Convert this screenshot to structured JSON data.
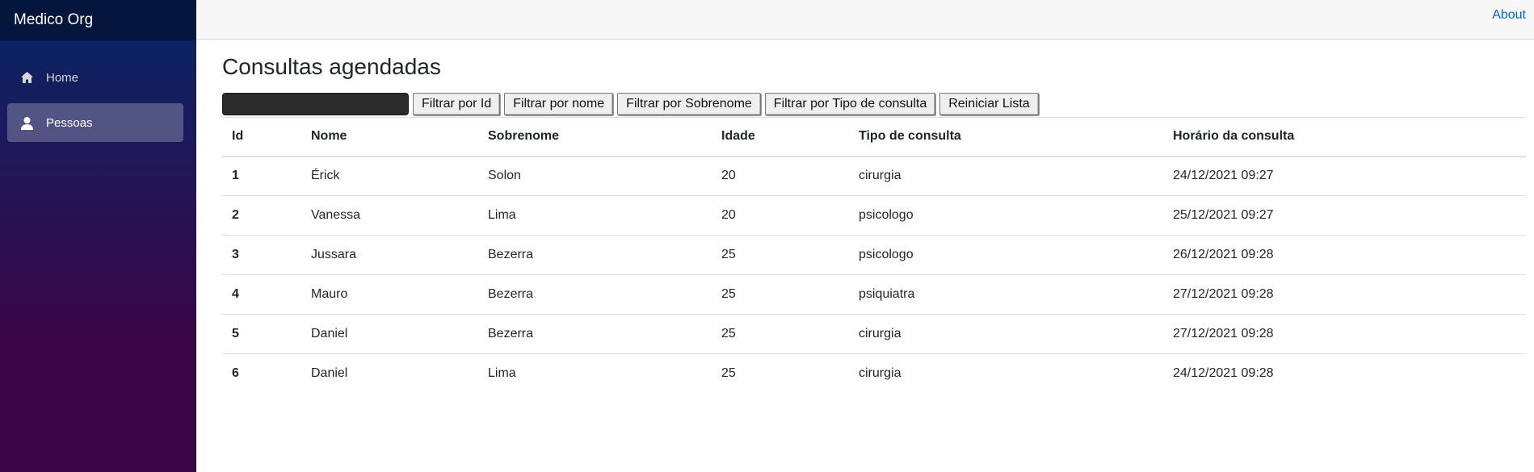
{
  "sidebar": {
    "brand": "Medico Org",
    "items": [
      {
        "label": "Home",
        "icon": "home-icon",
        "active": false
      },
      {
        "label": "Pessoas",
        "icon": "person-icon",
        "active": true
      }
    ]
  },
  "header": {
    "about_label": "About"
  },
  "main": {
    "title": "Consultas agendadas",
    "filter": {
      "input_value": "",
      "buttons": [
        "Filtrar por Id",
        "Filtrar por nome",
        "Filtrar por Sobrenome",
        "Filtrar por Tipo de consulta",
        "Reiniciar Lista"
      ]
    },
    "table": {
      "columns": [
        "Id",
        "Nome",
        "Sobrenome",
        "Idade",
        "Tipo de consulta",
        "Horário da consulta"
      ],
      "rows": [
        [
          "1",
          "Érick",
          "Solon",
          "20",
          "cirurgia",
          "24/12/2021 09:27"
        ],
        [
          "2",
          "Vanessa",
          "Lima",
          "20",
          "psicologo",
          "25/12/2021 09:27"
        ],
        [
          "3",
          "Jussara",
          "Bezerra",
          "25",
          "psicologo",
          "26/12/2021 09:28"
        ],
        [
          "4",
          "Mauro",
          "Bezerra",
          "25",
          "psiquiatra",
          "27/12/2021 09:28"
        ],
        [
          "5",
          "Daniel",
          "Bezerra",
          "25",
          "cirurgia",
          "27/12/2021 09:28"
        ],
        [
          "6",
          "Daniel",
          "Lima",
          "25",
          "cirurgia",
          "24/12/2021 09:28"
        ]
      ]
    }
  },
  "colors": {
    "sidebar_gradient_start": "#052767",
    "sidebar_gradient_end": "#3a0647",
    "link": "#0366d6",
    "top_bar": "#f7f7f7"
  }
}
